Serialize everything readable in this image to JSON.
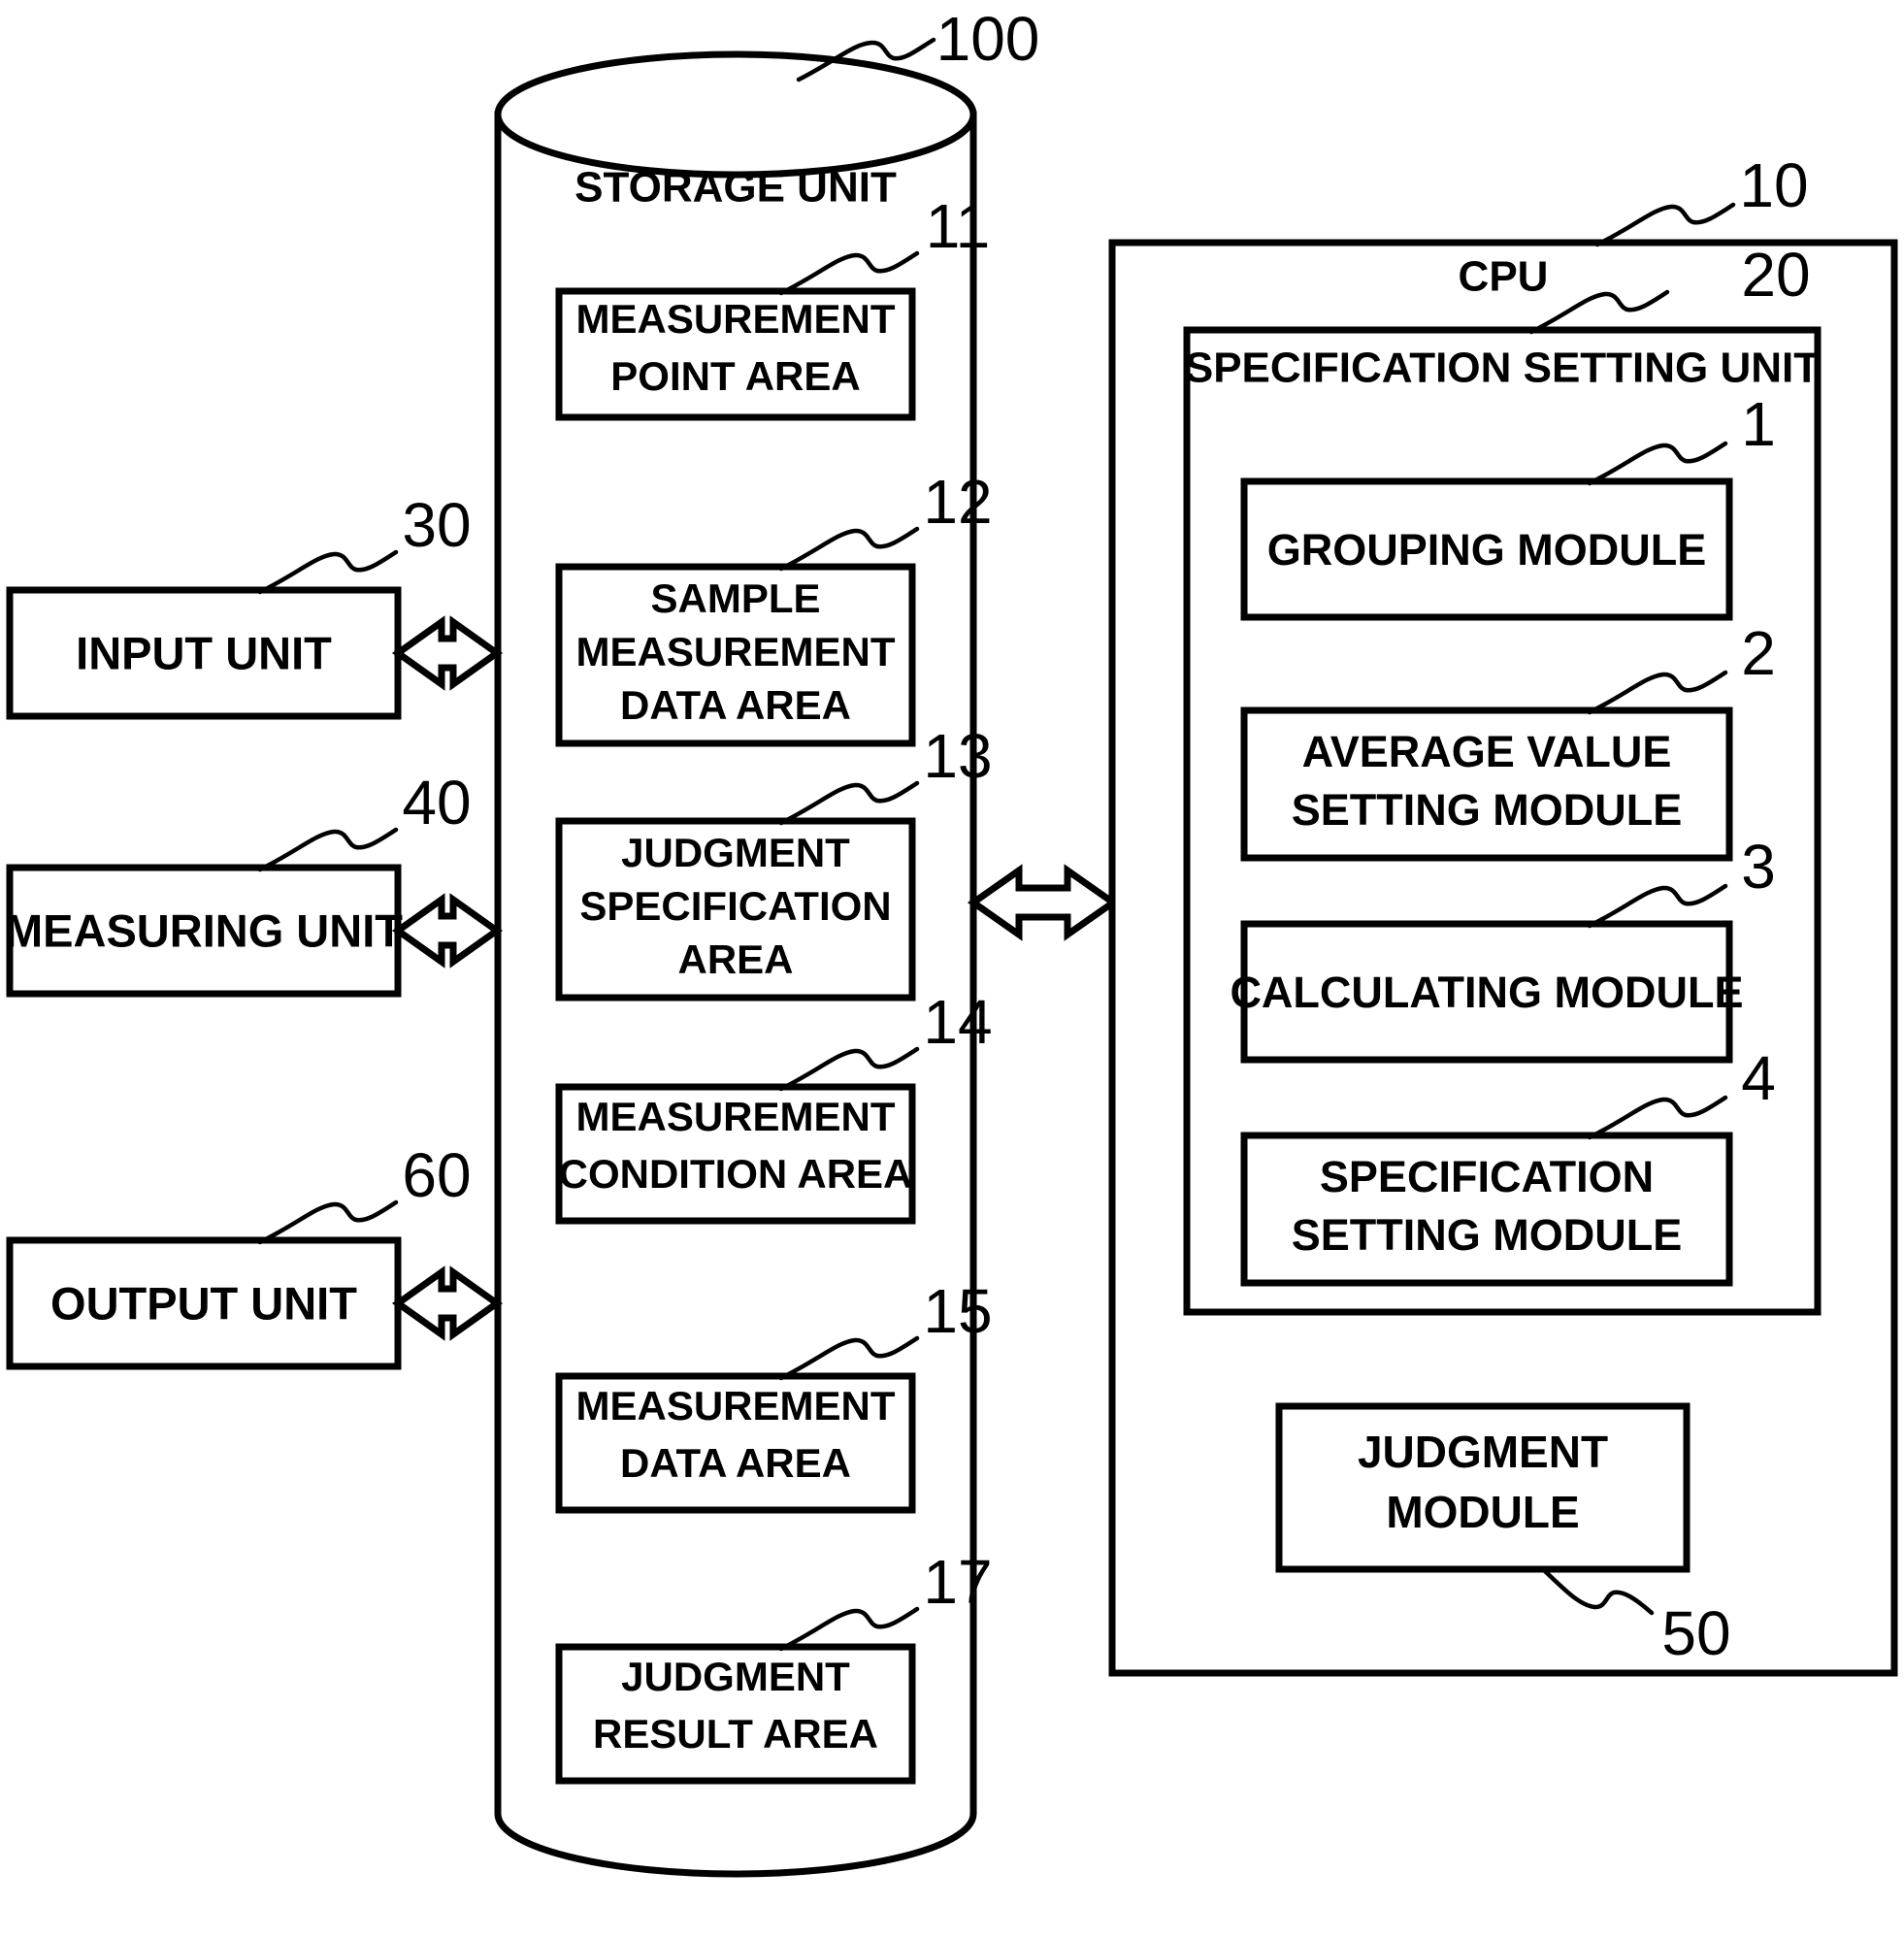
{
  "figure": {
    "type": "patent-block-diagram",
    "background_color": "#ffffff",
    "line_color": "#000000"
  },
  "storage": {
    "title": "STORAGE UNIT",
    "ref": "100",
    "areas": [
      {
        "ref": "11",
        "lines": [
          "MEASUREMENT",
          "POINT AREA"
        ]
      },
      {
        "ref": "12",
        "lines": [
          "SAMPLE",
          "MEASUREMENT",
          "DATA AREA"
        ]
      },
      {
        "ref": "13",
        "lines": [
          "JUDGMENT",
          "SPECIFICATION",
          "AREA"
        ]
      },
      {
        "ref": "14",
        "lines": [
          "MEASUREMENT",
          "CONDITION AREA"
        ]
      },
      {
        "ref": "15",
        "lines": [
          "MEASUREMENT",
          "DATA AREA"
        ]
      },
      {
        "ref": "17",
        "lines": [
          "JUDGMENT",
          "RESULT AREA"
        ]
      }
    ]
  },
  "peripherals": [
    {
      "ref": "30",
      "label": "INPUT UNIT"
    },
    {
      "ref": "40",
      "label": "MEASURING UNIT"
    },
    {
      "ref": "60",
      "label": "OUTPUT UNIT"
    }
  ],
  "cpu": {
    "title": "CPU",
    "ref": "10",
    "spec_setting_unit": {
      "title": "SPECIFICATION SETTING UNIT",
      "ref": "20",
      "modules": [
        {
          "ref": "1",
          "lines": [
            "GROUPING MODULE"
          ]
        },
        {
          "ref": "2",
          "lines": [
            "AVERAGE VALUE",
            "SETTING MODULE"
          ]
        },
        {
          "ref": "3",
          "lines": [
            "CALCULATING MODULE"
          ]
        },
        {
          "ref": "4",
          "lines": [
            "SPECIFICATION",
            "SETTING MODULE"
          ]
        }
      ]
    },
    "judgment_module": {
      "ref": "50",
      "lines": [
        "JUDGMENT",
        "MODULE"
      ]
    }
  },
  "connectors": [
    {
      "name": "input-to-storage",
      "style": "double-headed-hollow-arrow"
    },
    {
      "name": "measuring-to-storage",
      "style": "double-headed-hollow-arrow"
    },
    {
      "name": "output-to-storage",
      "style": "double-headed-hollow-arrow"
    },
    {
      "name": "storage-to-cpu",
      "style": "double-headed-hollow-arrow"
    }
  ]
}
